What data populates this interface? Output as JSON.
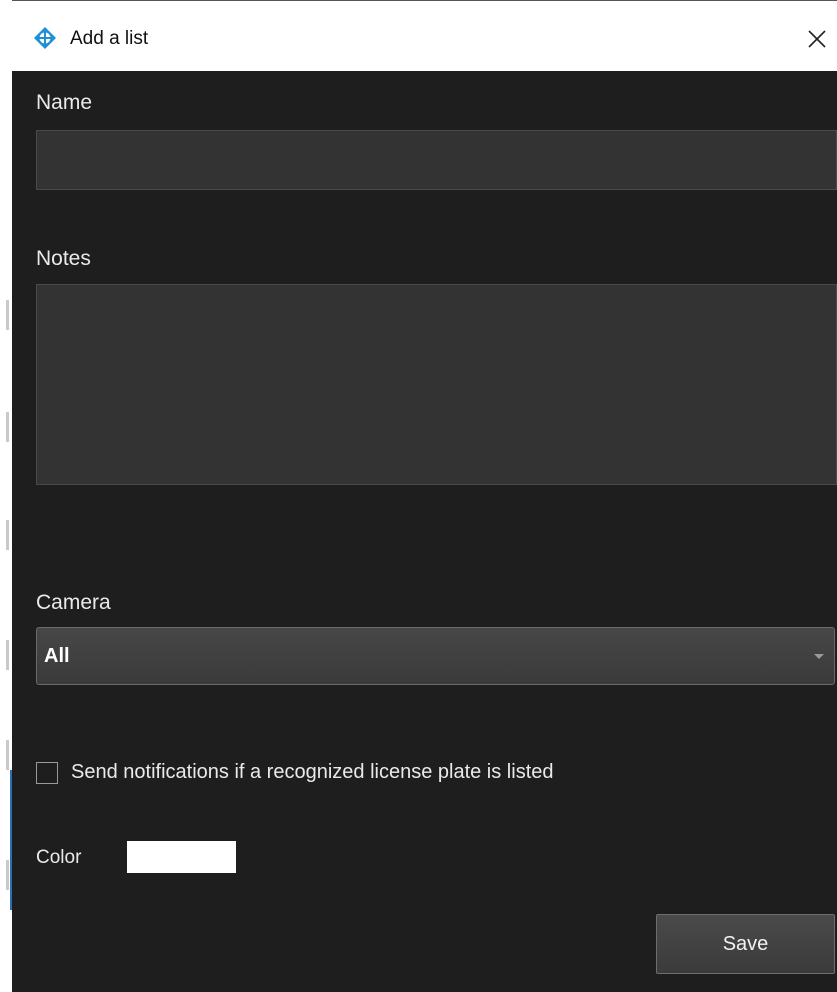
{
  "window": {
    "title": "Add a list",
    "close_symbol": "×",
    "icon": "app-logo-icon",
    "accent_color": "#1f8fd6"
  },
  "form": {
    "name_label": "Name",
    "name_value": "",
    "notes_label": "Notes",
    "notes_value": "",
    "camera_label": "Camera",
    "camera_selected": "All",
    "notification_checkbox_label": "Send notifications if a recognized license plate is listed",
    "notification_checked": false,
    "color_label": "Color",
    "color_value": "#ffffff",
    "save_label": "Save"
  }
}
